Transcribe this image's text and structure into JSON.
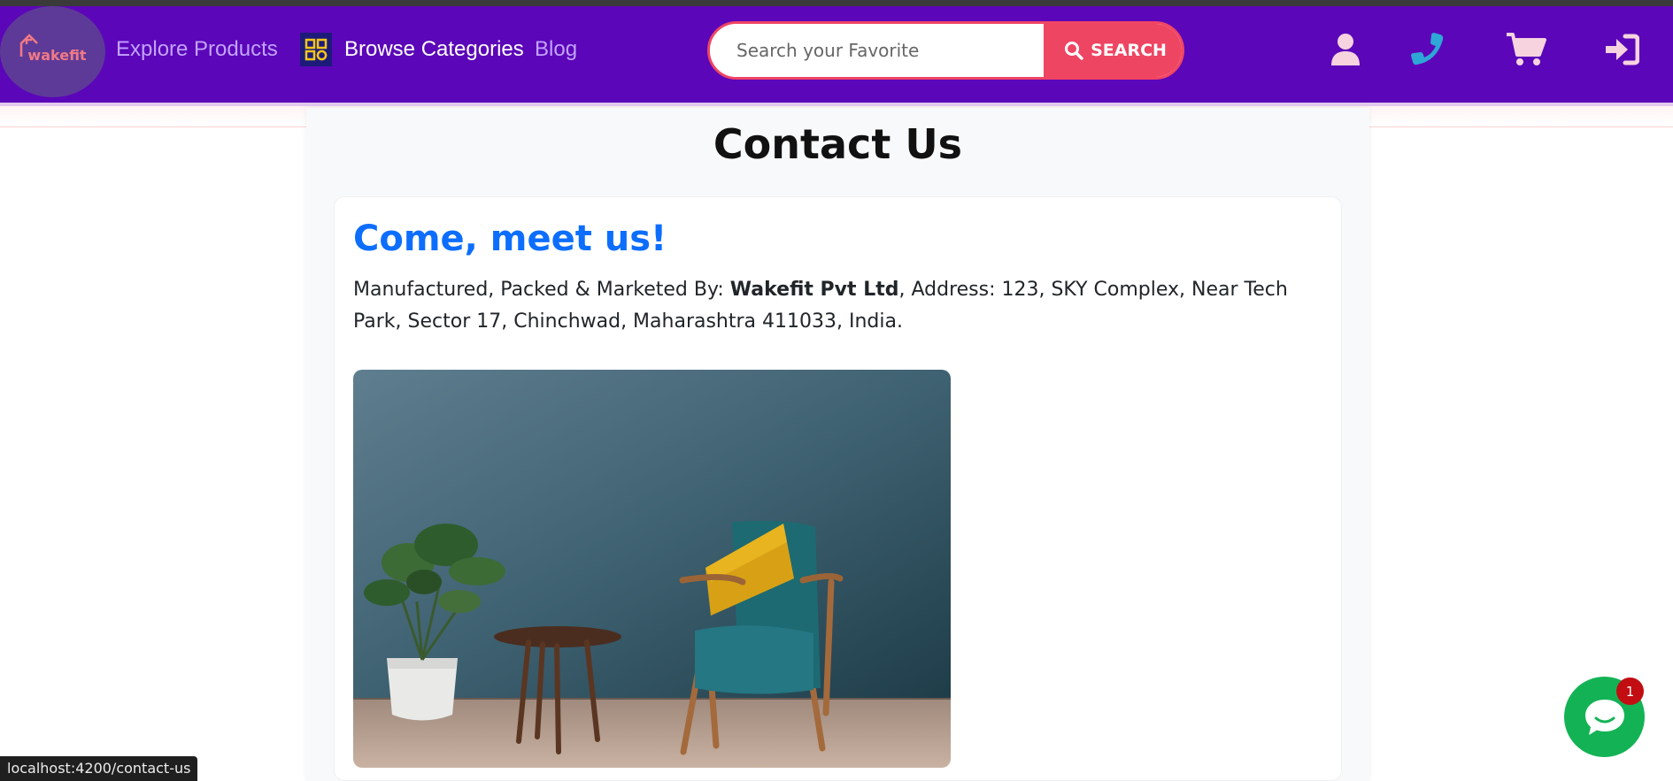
{
  "nav": {
    "logo_text": "wakefit",
    "explore_label": "Explore Products",
    "browse_label": "Browse Categories",
    "blog_label": "Blog",
    "search_placeholder": "Search your Favorite",
    "search_button_label": "SEARCH",
    "icons": [
      "user-icon",
      "phone-icon",
      "cart-icon",
      "sign-in-icon"
    ]
  },
  "page": {
    "title": "Contact Us",
    "card_heading": "Come, meet us!",
    "address_prefix": "Manufactured, Packed & Marketed By: ",
    "company_name": "Wakefit Pvt Ltd",
    "address_suffix": ", Address: 123, SKY Complex, Near Tech Park, Sector 17, Chinchwad, Maharashtra 411033, India."
  },
  "chat": {
    "badge_count": "1"
  },
  "status_bar": {
    "url": "localhost:4200/contact-us"
  },
  "colors": {
    "navbar": "#5b06b8",
    "search_accent": "#ee4562",
    "heading_blue": "#0d6efd",
    "chat_green": "#13b355"
  }
}
